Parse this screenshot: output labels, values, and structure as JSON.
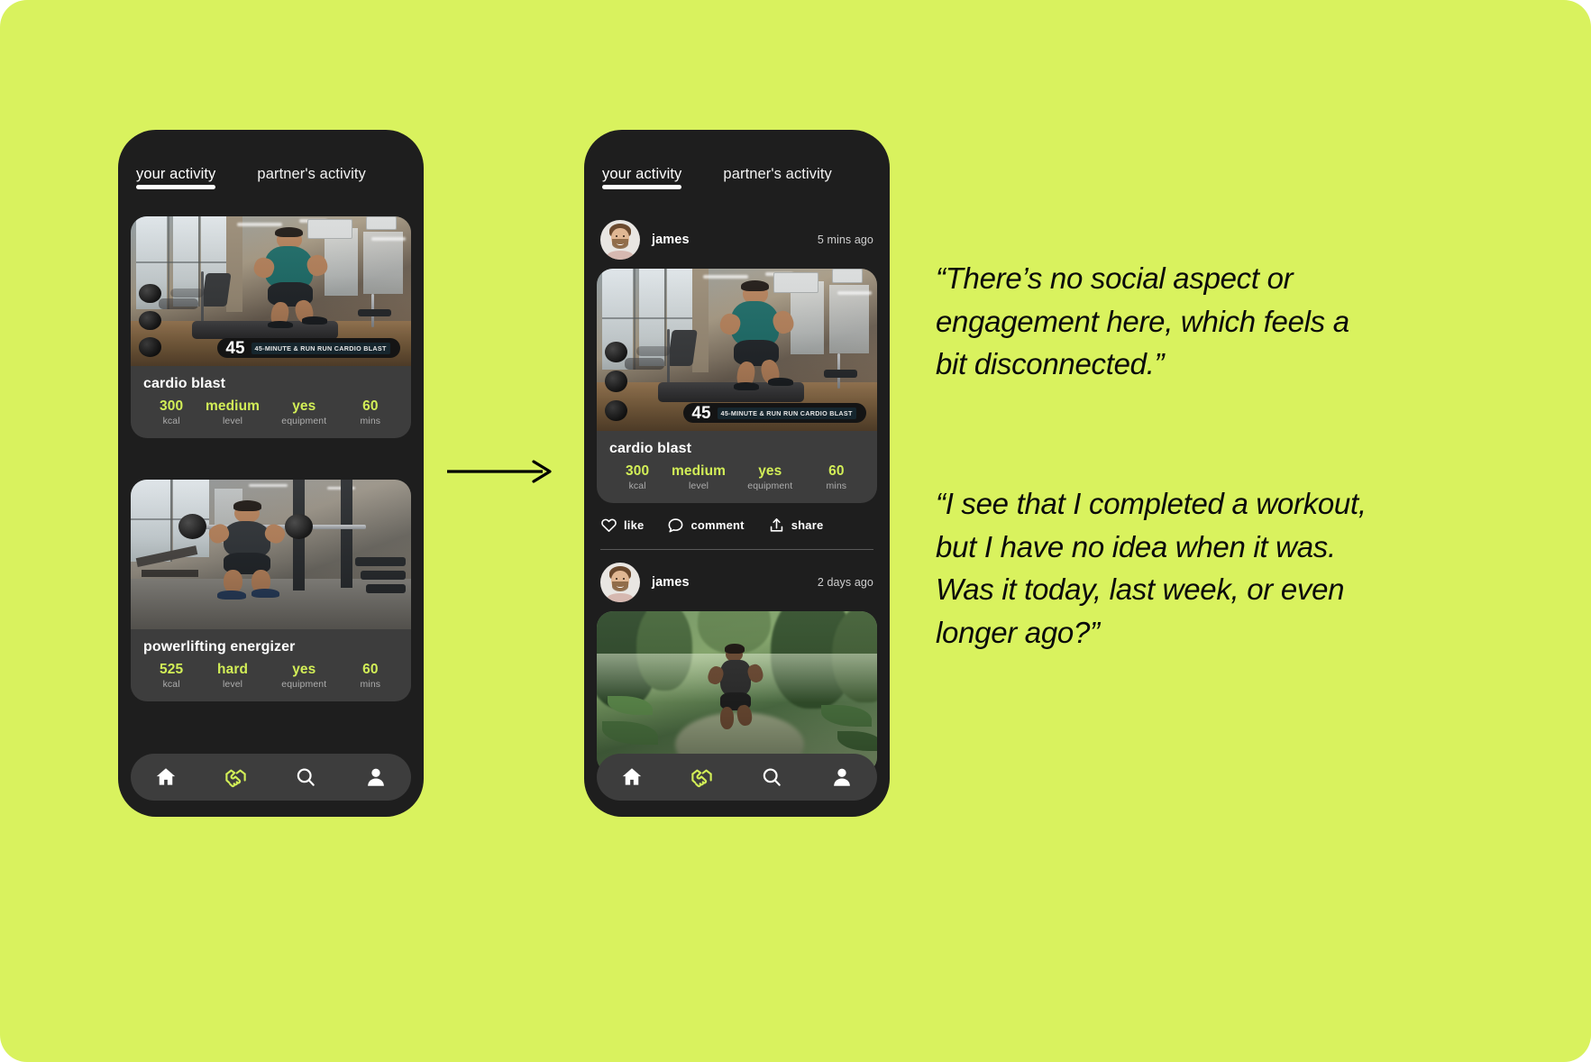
{
  "canvas": {
    "background_color": "#d9f25e"
  },
  "phone_left": {
    "tabs": [
      {
        "label": "your activity",
        "active": true
      },
      {
        "label": "partner's activity",
        "active": false
      }
    ],
    "cards": [
      {
        "image_alt": "man running on treadmill in gym",
        "overlay_number": "45",
        "overlay_ticker": "45-MINUTE & RUN RUN CARDIO BLAST",
        "title": "cardio blast",
        "stats": [
          {
            "value": "300",
            "label": "kcal"
          },
          {
            "value": "medium",
            "label": "level"
          },
          {
            "value": "yes",
            "label": "equipment"
          },
          {
            "value": "60",
            "label": "mins"
          }
        ]
      },
      {
        "image_alt": "man performing barbell front squat in gym",
        "title": "powerlifting energizer",
        "stats": [
          {
            "value": "525",
            "label": "kcal"
          },
          {
            "value": "hard",
            "label": "level"
          },
          {
            "value": "yes",
            "label": "equipment"
          },
          {
            "value": "60",
            "label": "mins"
          }
        ]
      }
    ],
    "nav": [
      {
        "icon": "home-icon",
        "active": false
      },
      {
        "icon": "handshake-icon",
        "active": true
      },
      {
        "icon": "search-icon",
        "active": false
      },
      {
        "icon": "person-icon",
        "active": false
      }
    ]
  },
  "phone_right": {
    "tabs": [
      {
        "label": "your activity",
        "active": true
      },
      {
        "label": "partner's activity",
        "active": false
      }
    ],
    "posts": [
      {
        "user": "james",
        "time": "5 mins ago",
        "image_alt": "man running on treadmill in gym",
        "overlay_number": "45",
        "overlay_ticker": "45-MINUTE & RUN RUN CARDIO BLAST",
        "title": "cardio blast",
        "stats": [
          {
            "value": "300",
            "label": "kcal"
          },
          {
            "value": "medium",
            "label": "level"
          },
          {
            "value": "yes",
            "label": "equipment"
          },
          {
            "value": "60",
            "label": "mins"
          }
        ],
        "actions": [
          {
            "icon": "heart-icon",
            "label": "like"
          },
          {
            "icon": "comment-icon",
            "label": "comment"
          },
          {
            "icon": "share-icon",
            "label": "share"
          }
        ]
      },
      {
        "user": "james",
        "time": "2 days ago",
        "image_alt": "woman running on a jungle trail"
      }
    ],
    "nav": [
      {
        "icon": "home-icon",
        "active": false
      },
      {
        "icon": "handshake-icon",
        "active": true
      },
      {
        "icon": "search-icon",
        "active": false
      },
      {
        "icon": "person-icon",
        "active": false
      }
    ]
  },
  "annotations": {
    "quote_1": "“There’s no social aspect or engagement here, which feels a bit disconnected.”",
    "quote_2": "“I see that I completed a workout, but I have no idea when it was. Was it today, last week, or even longer ago?”"
  },
  "colors": {
    "background": "#d9f25e",
    "phone_body": "#1e1e1e",
    "card": "#3d3d3d",
    "accent_lime": "#d2ee57",
    "text_primary": "#ffffff",
    "text_muted": "#adadad"
  }
}
